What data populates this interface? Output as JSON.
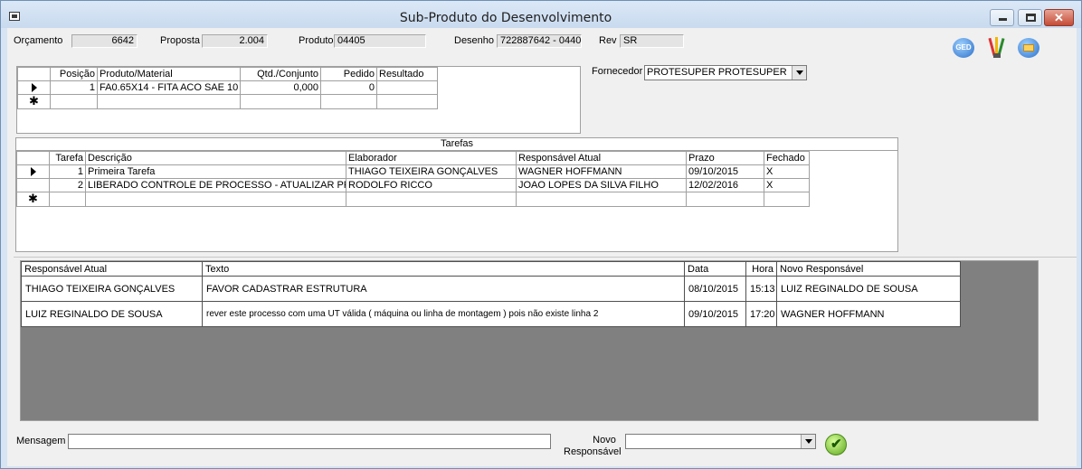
{
  "window": {
    "title": "Sub-Produto do Desenvolvimento"
  },
  "header": {
    "orcamento_label": "Orçamento",
    "orcamento_value": "6642",
    "proposta_label": "Proposta",
    "proposta_value": "2.004",
    "produto_label": "Produto",
    "produto_value": "04405",
    "desenho_label": "Desenho",
    "desenho_value": "722887642 - 0440",
    "rev_label": "Rev",
    "rev_value": "SR"
  },
  "icons": {
    "ged_label": "GED"
  },
  "materials": {
    "headers": [
      "Posição",
      "Produto/Material",
      "Qtd./Conjunto",
      "Pedido",
      "Resultado"
    ],
    "rows": [
      {
        "posicao": "1",
        "produto": "FA0.65X14  -  FITA ACO SAE 10",
        "qtd": "0,000",
        "pedido": "0",
        "resultado": ""
      }
    ]
  },
  "fornecedor": {
    "label": "Fornecedor",
    "value": "PROTESUPER   PROTESUPER"
  },
  "tarefas": {
    "caption": "Tarefas",
    "headers": [
      "Tarefa",
      "Descrição",
      "Elaborador",
      "Responsável Atual",
      "Prazo",
      "Fechado"
    ],
    "rows": [
      {
        "tarefa": "1",
        "descricao": "Primeira Tarefa",
        "elaborador": "THIAGO TEIXEIRA GONÇALVES",
        "responsavel": "WAGNER HOFFMANN",
        "prazo": "09/10/2015",
        "fechado": "X"
      },
      {
        "tarefa": "2",
        "descricao": "LIBERADO CONTROLE DE PROCESSO - ATUALIZAR PP.",
        "elaborador": "RODOLFO RICCO",
        "responsavel": "JOAO LOPES DA SILVA FILHO",
        "prazo": "12/02/2016",
        "fechado": "X"
      }
    ]
  },
  "historico": {
    "headers": [
      "Responsável Atual",
      "Texto",
      "Data",
      "Hora",
      "Novo Responsável"
    ],
    "rows": [
      {
        "responsavel": "THIAGO TEIXEIRA GONÇALVES",
        "texto": "FAVOR CADASTRAR ESTRUTURA",
        "data": "08/10/2015",
        "hora": "15:13",
        "novo": "LUIZ REGINALDO DE SOUSA"
      },
      {
        "responsavel": "LUIZ REGINALDO DE SOUSA",
        "texto": "rever este processo com uma UT válida ( máquina ou linha de montagem ) pois não existe linha 2",
        "data": "09/10/2015",
        "hora": "17:20",
        "novo": "WAGNER HOFFMANN"
      }
    ]
  },
  "footer": {
    "mensagem_label": "Mensagem",
    "mensagem_value": "",
    "novo_label_line1": "Novo",
    "novo_label_line2": "Responsável",
    "novo_value": ""
  }
}
